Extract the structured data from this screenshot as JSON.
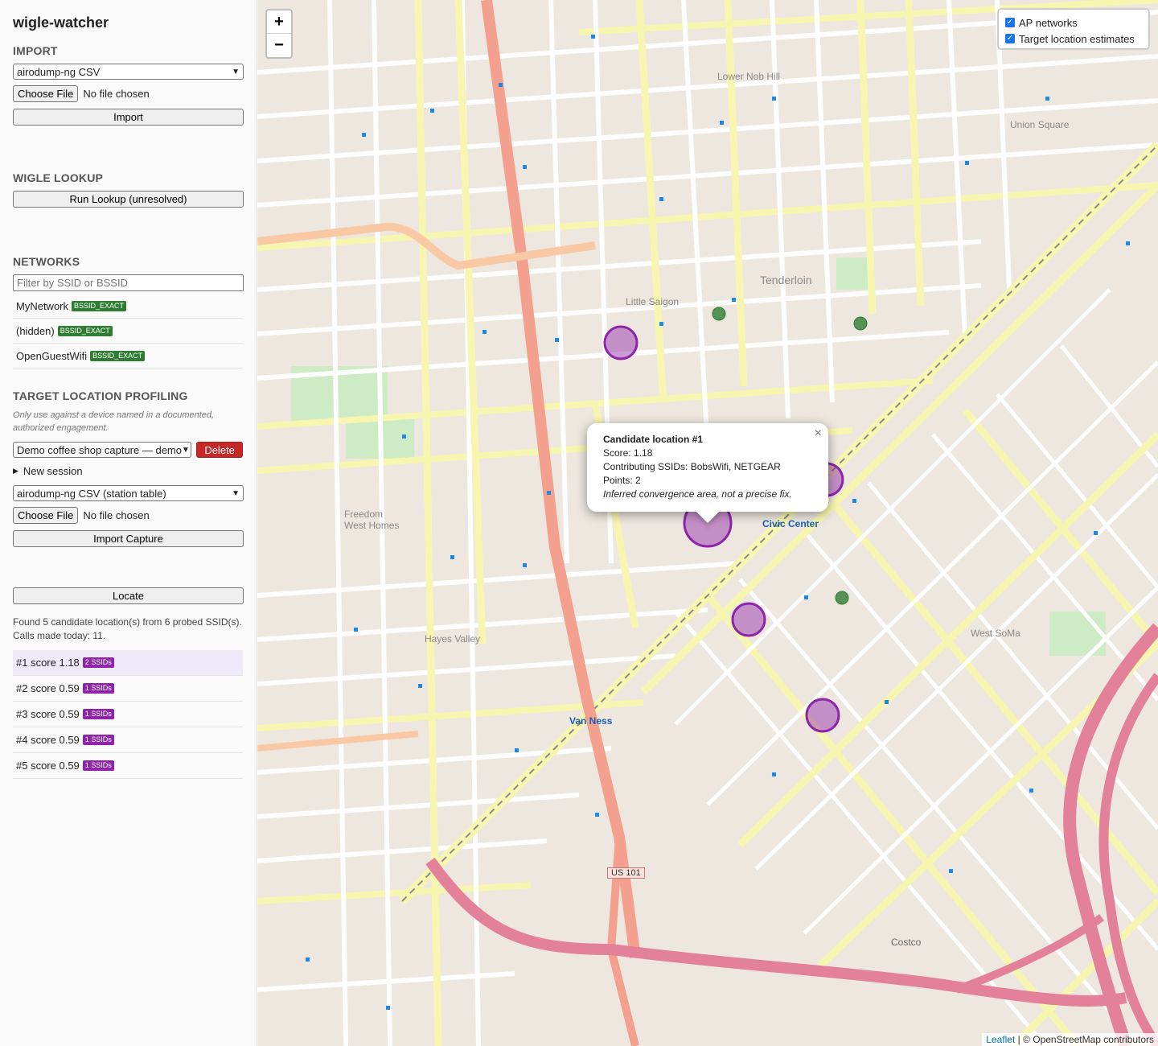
{
  "app": {
    "title": "wigle-watcher"
  },
  "import": {
    "heading": "IMPORT",
    "format": "airodump-ng CSV",
    "choose_label": "Choose File",
    "file_status": "No file chosen",
    "import_label": "Import"
  },
  "lookup": {
    "heading": "WIGLE LOOKUP",
    "run_label": "Run Lookup (unresolved)"
  },
  "networks": {
    "heading": "NETWORKS",
    "filter_placeholder": "Filter by SSID or BSSID",
    "items": [
      {
        "ssid": "MyNetwork",
        "badge": "BSSID_EXACT"
      },
      {
        "ssid": "(hidden)",
        "badge": "BSSID_EXACT"
      },
      {
        "ssid": "OpenGuestWifi",
        "badge": "BSSID_EXACT"
      }
    ]
  },
  "profiling": {
    "heading": "TARGET LOCATION PROFILING",
    "note": "Only use against a device named in a documented, authorized engagement.",
    "session_select": "Demo coffee shop capture — demo",
    "delete_label": "Delete",
    "new_session_label": "New session",
    "capture_format": "airodump-ng CSV (station table)",
    "choose_label": "Choose File",
    "file_status": "No file chosen",
    "import_capture_label": "Import Capture",
    "locate_label": "Locate",
    "result_text": "Found 5 candidate location(s) from 6 probed SSID(s). Calls made today: 11.",
    "candidates": [
      {
        "label": "#1 score 1.18",
        "badge": "2 SSIDs"
      },
      {
        "label": "#2 score 0.59",
        "badge": "1 SSIDs"
      },
      {
        "label": "#3 score 0.59",
        "badge": "1 SSIDs"
      },
      {
        "label": "#4 score 0.59",
        "badge": "1 SSIDs"
      },
      {
        "label": "#5 score 0.59",
        "badge": "1 SSIDs"
      }
    ]
  },
  "map": {
    "zoom_in": "+",
    "zoom_out": "−",
    "layers": {
      "ap": "AP networks",
      "targets": "Target location estimates",
      "ap_checked": true,
      "targets_checked": true
    },
    "popup": {
      "title": "Candidate location #1",
      "score": "Score: 1.18",
      "ssids": "Contributing SSIDs: BobsWifi, NETGEAR",
      "points": "Points: 2",
      "note": "Inferred convergence area, not a precise fix.",
      "close": "×"
    },
    "attribution": {
      "leaflet": "Leaflet",
      "osm": "| © OpenStreetMap contributors"
    },
    "labels": {
      "tenderloin": "Tenderloin",
      "little_saigon": "Little Saigon",
      "civic_center": "Civic Center",
      "union_square": "Union Square",
      "hayes_valley": "Hayes Valley",
      "west_soma": "West SoMa",
      "van_ness": "Van Ness",
      "freedom_west": "Freedom West Homes",
      "costco": "Costco",
      "lower_nob_hill": "Lower Nob Hill",
      "us101": "US 101"
    },
    "colors": {
      "candidate": "#8e24aa",
      "ap": "#2e7d32",
      "major_road": "#f3a08f",
      "road": "#f7f6b0"
    }
  }
}
